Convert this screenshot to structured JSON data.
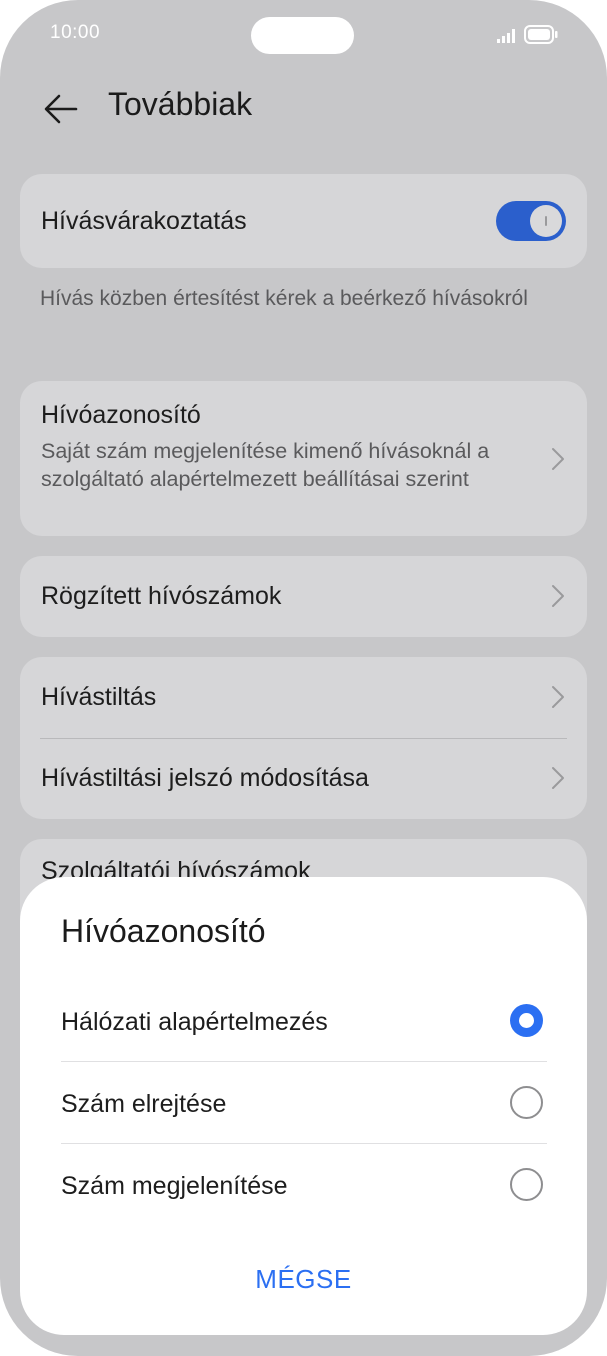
{
  "status_bar": {
    "time": "10:00",
    "signal_icon": "signal-icon",
    "battery_icon": "battery-icon"
  },
  "header": {
    "title": "Továbbiak",
    "back_icon": "arrow-left-icon"
  },
  "settings": {
    "call_waiting": {
      "label": "Hívásvárakoztatás",
      "enabled": true,
      "hint": "Hívás közben értesítést kérek a beérkező hívásokról"
    },
    "caller_id": {
      "label": "Hívóazonosító",
      "description": "Saját szám megjelenítése kimenő hívásoknál a szolgáltató alapértelmezett beállításai szerint"
    },
    "fixed_dialing": {
      "label": "Rögzített hívószámok"
    },
    "call_barring": {
      "label": "Hívástiltás"
    },
    "barring_password": {
      "label": "Hívástiltási jelszó módosítása"
    },
    "service_numbers": {
      "label": "Szolgáltatói hívószámok"
    }
  },
  "dialog": {
    "title": "Hívóazonosító",
    "options": [
      {
        "label": "Hálózati alapértelmezés",
        "selected": true
      },
      {
        "label": "Szám elrejtése",
        "selected": false
      },
      {
        "label": "Szám megjelenítése",
        "selected": false
      }
    ],
    "cancel_label": "MÉGSE"
  },
  "colors": {
    "accent": "#2b6ff2",
    "toggle_on": "#2b5fcc",
    "background": "#c7c7c9",
    "card": "#d6d6d8"
  }
}
